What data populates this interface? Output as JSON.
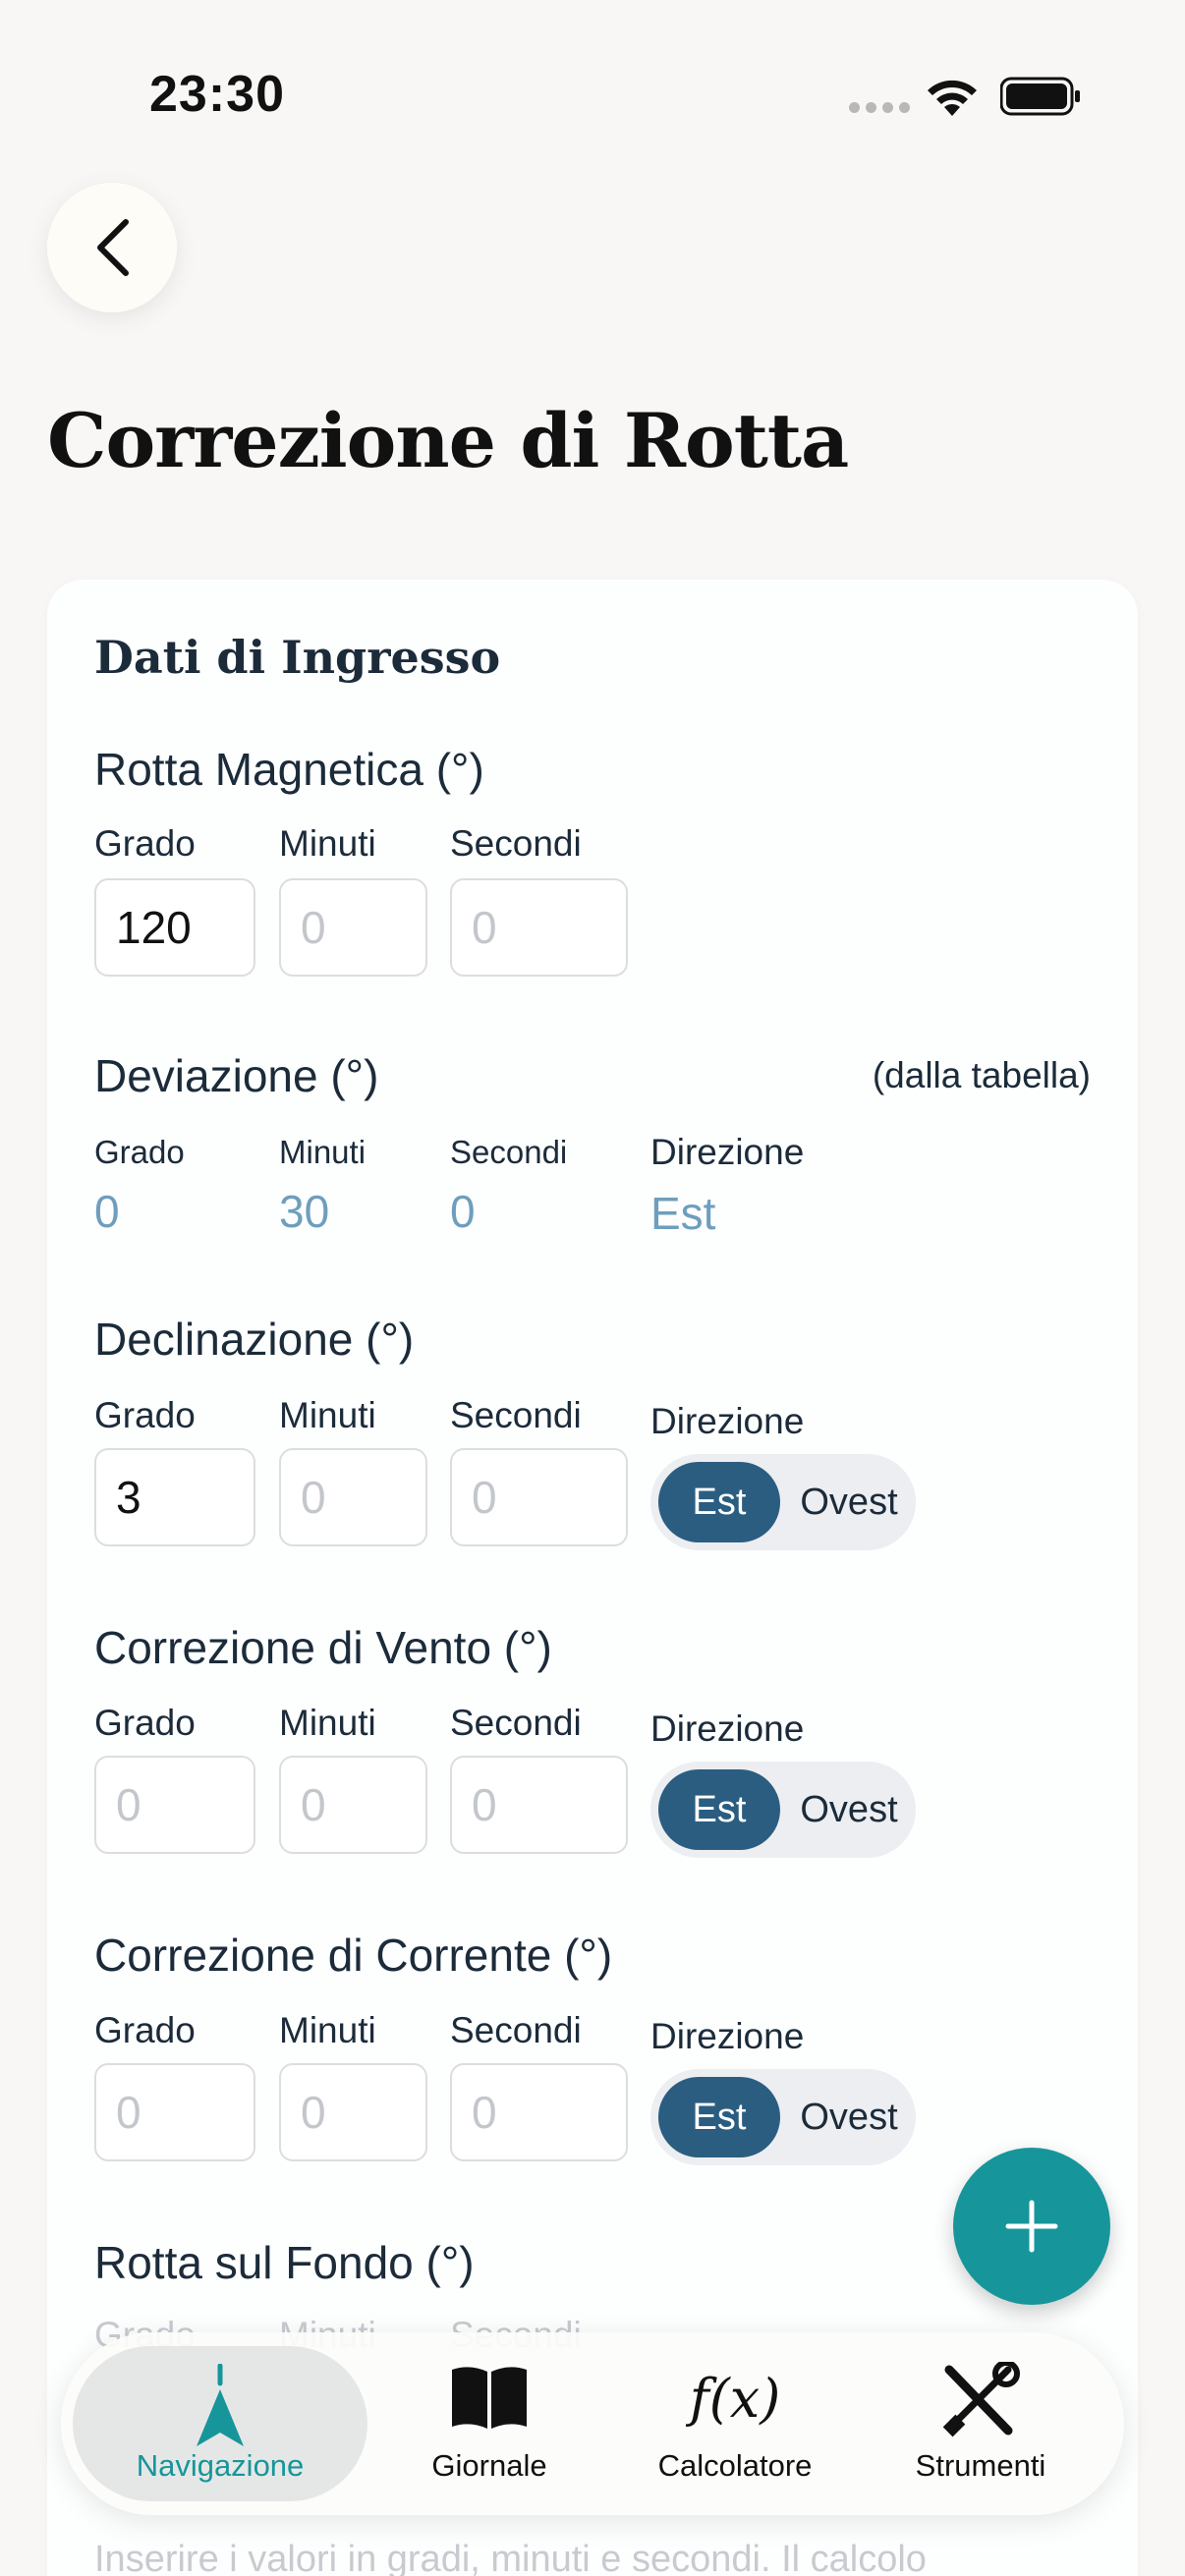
{
  "status": {
    "time": "23:30"
  },
  "page": {
    "title": "Correzione di Rotta"
  },
  "card": {
    "title": "Dati di Ingresso"
  },
  "labels": {
    "grado": "Grado",
    "minuti": "Minuti",
    "secondi": "Secondi",
    "direzione": "Direzione",
    "est": "Est",
    "ovest": "Ovest"
  },
  "rotta_magnetica": {
    "title": "Rotta Magnetica (°)",
    "grado": "120",
    "minuti_placeholder": "0",
    "secondi_placeholder": "0"
  },
  "deviazione": {
    "title": "Deviazione (°)",
    "note": "(dalla tabella)",
    "grado": "0",
    "minuti": "30",
    "secondi": "0",
    "direzione": "Est"
  },
  "declinazione": {
    "title": "Declinazione (°)",
    "grado": "3",
    "minuti_placeholder": "0",
    "secondi_placeholder": "0",
    "selected": "Est"
  },
  "vento": {
    "title": "Correzione di Vento (°)",
    "grado_placeholder": "0",
    "minuti_placeholder": "0",
    "secondi_placeholder": "0",
    "selected": "Est"
  },
  "corrente": {
    "title": "Correzione di Corrente (°)",
    "grado_placeholder": "0",
    "minuti_placeholder": "0",
    "secondi_placeholder": "0",
    "selected": "Est"
  },
  "fondo": {
    "title": "Rotta sul Fondo (°)"
  },
  "hint": "Inserire i valori in gradi, minuti e secondi. Il calcolo",
  "tabs": [
    {
      "label": "Navigazione",
      "icon": "navigation-arrow-icon",
      "active": true
    },
    {
      "label": "Giornale",
      "icon": "book-icon"
    },
    {
      "label": "Calcolatore",
      "icon": "function-icon"
    },
    {
      "label": "Strumenti",
      "icon": "tools-icon"
    }
  ],
  "colors": {
    "accent": "#16969a",
    "toggle_active": "#2b5d81",
    "readonly_value": "#6e9ebd"
  }
}
